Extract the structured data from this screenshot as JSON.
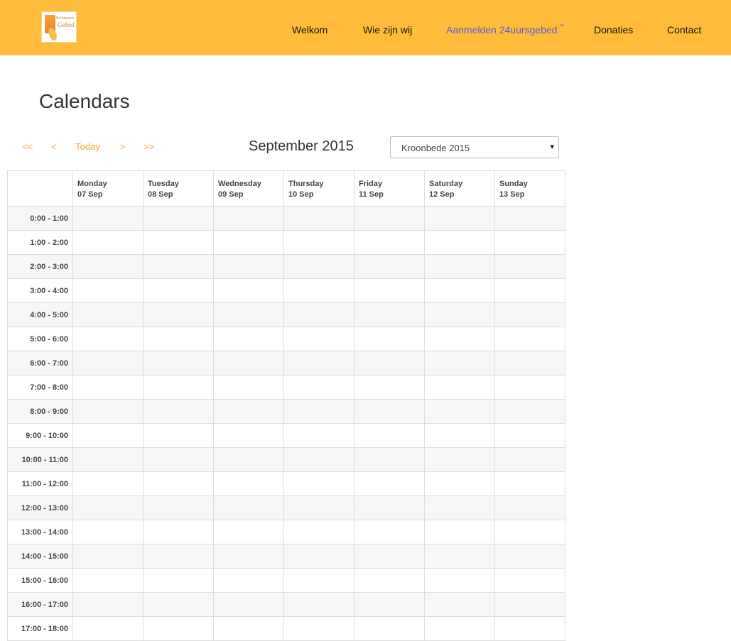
{
  "header": {
    "logo": {
      "line1": "Investeren",
      "line2": "Gebed"
    },
    "nav": [
      {
        "label": "Welkom"
      },
      {
        "label": "Wie zijn wij"
      },
      {
        "label": "Aanmelden 24uursgebed",
        "active": true,
        "has_dropdown": true
      },
      {
        "label": "Donaties"
      },
      {
        "label": "Contact"
      }
    ],
    "colors": {
      "bar": "#ffbc3a",
      "active": "#5a5be0",
      "link": "#f4a43a"
    }
  },
  "page": {
    "title": "Calendars"
  },
  "toolbar": {
    "prev_year": "<<",
    "prev": "<",
    "today": "Today",
    "next": ">",
    "next_year": ">>",
    "month": "September 2015",
    "calendar_select": {
      "value": "Kroonbede 2015",
      "caret": "▾"
    }
  },
  "calendar": {
    "days": [
      {
        "name": "Monday",
        "date": "07 Sep"
      },
      {
        "name": "Tuesday",
        "date": "08 Sep"
      },
      {
        "name": "Wednesday",
        "date": "09 Sep"
      },
      {
        "name": "Thursday",
        "date": "10 Sep"
      },
      {
        "name": "Friday",
        "date": "11 Sep"
      },
      {
        "name": "Saturday",
        "date": "12 Sep"
      },
      {
        "name": "Sunday",
        "date": "13 Sep"
      }
    ],
    "slots": [
      "0:00 - 1:00",
      "1:00 - 2:00",
      "2:00 - 3:00",
      "3:00 - 4:00",
      "4:00 - 5:00",
      "5:00 - 6:00",
      "6:00 - 7:00",
      "7:00 - 8:00",
      "8:00 - 9:00",
      "9:00 - 10:00",
      "10:00 - 11:00",
      "11:00 - 12:00",
      "12:00 - 13:00",
      "13:00 - 14:00",
      "14:00 - 15:00",
      "15:00 - 16:00",
      "16:00 - 17:00",
      "17:00 - 18:00"
    ]
  }
}
